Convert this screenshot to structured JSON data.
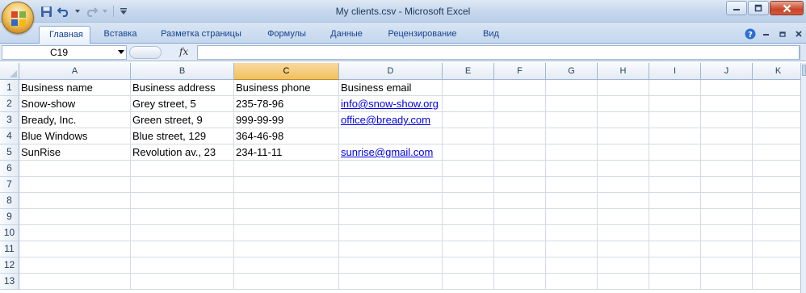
{
  "window": {
    "title": "My clients.csv - Microsoft Excel"
  },
  "quick_access": {
    "icons": [
      "save-icon",
      "undo-icon",
      "redo-icon",
      "customize-icon"
    ]
  },
  "ribbon": {
    "tabs": [
      {
        "label": "Главная",
        "active": true
      },
      {
        "label": "Вставка",
        "active": false
      },
      {
        "label": "Разметка страницы",
        "active": false
      },
      {
        "label": "Формулы",
        "active": false
      },
      {
        "label": "Данные",
        "active": false
      },
      {
        "label": "Рецензирование",
        "active": false
      },
      {
        "label": "Вид",
        "active": false
      }
    ]
  },
  "formula_bar": {
    "name_box": "C19",
    "fx_label": "fx",
    "formula": ""
  },
  "sheet": {
    "selected_column": "C",
    "columns": [
      "A",
      "B",
      "C",
      "D",
      "E",
      "F",
      "G",
      "H",
      "I",
      "J",
      "K"
    ],
    "rows": [
      "1",
      "2",
      "3",
      "4",
      "5",
      "6",
      "7",
      "8",
      "9",
      "10",
      "11",
      "12",
      "13"
    ],
    "data": [
      [
        "Business name",
        "Business address",
        "Business phone",
        "Business email"
      ],
      [
        "Snow-show",
        "Grey street, 5",
        "235-78-96",
        "info@snow-show.org"
      ],
      [
        "Bready, Inc.",
        "Green street, 9",
        "999-99-99",
        "office@bready.com"
      ],
      [
        "Blue Windows",
        "Blue street, 129",
        "364-46-98",
        ""
      ],
      [
        "SunRise",
        "Revolution av., 23",
        "234-11-11",
        "sunrise@gmail.com"
      ]
    ]
  },
  "colors": {
    "link": "#0000ee",
    "selected_header": "#f1c15f",
    "ribbon_text": "#15428b"
  }
}
